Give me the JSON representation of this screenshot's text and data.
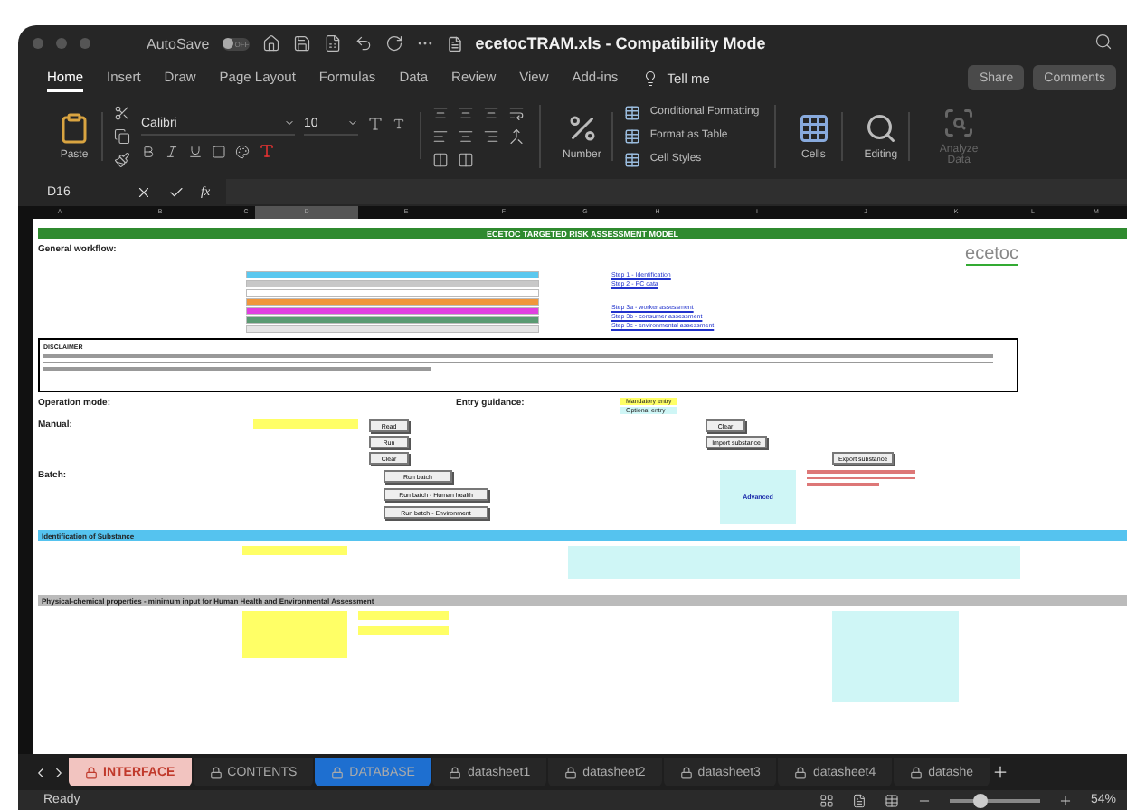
{
  "window": {
    "title": "ecetocTRAM.xls  -  Compatibility Mode",
    "autosave": "AutoSave",
    "autosave_state": "OFF",
    "autosave_on": false
  },
  "ribbon_tabs": [
    {
      "label": "Home",
      "selected": true
    },
    {
      "label": "Insert",
      "selected": false
    },
    {
      "label": "Draw",
      "selected": false
    },
    {
      "label": "Page Layout",
      "selected": false
    },
    {
      "label": "Formulas",
      "selected": false
    },
    {
      "label": "Data",
      "selected": false
    },
    {
      "label": "Review",
      "selected": false
    },
    {
      "label": "View",
      "selected": false
    },
    {
      "label": "Add-ins",
      "selected": false
    }
  ],
  "tell_me": "Tell me",
  "share": "Share",
  "comments": "Comments",
  "ribbon": {
    "paste": "Paste",
    "font": "Calibri",
    "size": "10",
    "number": "Number",
    "styles": [
      "Conditional Formatting",
      "Format as Table",
      "Cell Styles"
    ],
    "cells": "Cells",
    "editing": "Editing",
    "analyze": {
      "label": "Analyze Data",
      "disabled": true
    }
  },
  "formula_bar": {
    "cell": "D16",
    "fx": "fx"
  },
  "columns": [
    {
      "label": "A",
      "selected": false
    },
    {
      "label": "B",
      "selected": false
    },
    {
      "label": "C",
      "selected": false
    },
    {
      "label": "D",
      "selected": true
    },
    {
      "label": "E",
      "selected": false
    },
    {
      "label": "F",
      "selected": false
    },
    {
      "label": "G",
      "selected": false
    },
    {
      "label": "H",
      "selected": false
    },
    {
      "label": "I",
      "selected": false
    },
    {
      "label": "J",
      "selected": false
    },
    {
      "label": "K",
      "selected": false
    },
    {
      "label": "L",
      "selected": false
    },
    {
      "label": "M",
      "selected": false
    }
  ],
  "sheet": {
    "title": "ECETOC TARGETED RISK ASSESSMENT MODEL",
    "logo": "ecetoc",
    "workflow_heading": "General workflow:",
    "steps": [
      {
        "color": "#5bc8ef"
      },
      {
        "color": "#c8c8c8"
      },
      {
        "color": "#ffffff"
      },
      {
        "color": "#f0963c"
      },
      {
        "color": "#e040e0"
      },
      {
        "color": "#5a9a72"
      },
      {
        "color": "#e4e4e4"
      }
    ],
    "links": [
      "Step 1 - Identification",
      "Step 2 - PC data",
      "Step 3a - worker assessment",
      "Step 3b - consumer assessment",
      "Step 3c - environmental assessment"
    ],
    "disclaimer": "DISCLAIMER",
    "operation_mode": "Operation mode:",
    "entry_guidance": "Entry guidance:",
    "legend": [
      {
        "label": "Mandatory entry",
        "color": "#ffff66"
      },
      {
        "label": "Optional entry",
        "color": "#cff6f6"
      }
    ],
    "manual": {
      "heading": "Manual:",
      "buttons": [
        "Read",
        "Run",
        "Clear"
      ],
      "side_buttons": [
        "Clear",
        "Import substance",
        "Export substance"
      ]
    },
    "batch": {
      "heading": "Batch:",
      "buttons": [
        "Run batch",
        "Run batch - Human health",
        "Run batch - Environment"
      ],
      "advanced": "Advanced"
    },
    "identification": "Identification of Substance",
    "physchem": "Physical-chemical properties - minimum input for Human Health and Environmental Assessment"
  },
  "sheet_tabs": [
    {
      "label": "INTERFACE",
      "color": "#f2c4c0",
      "selected": true
    },
    {
      "label": "CONTENTS",
      "color": "#262626",
      "selected": false
    },
    {
      "label": "DATABASE",
      "color": "#1e6fd0",
      "selected": false
    },
    {
      "label": "datasheet1",
      "color": "#262626",
      "selected": false
    },
    {
      "label": "datasheet2",
      "color": "#262626",
      "selected": false
    },
    {
      "label": "datasheet3",
      "color": "#262626",
      "selected": false
    },
    {
      "label": "datasheet4",
      "color": "#262626",
      "selected": false
    },
    {
      "label": "datashe",
      "color": "#262626",
      "selected": false
    }
  ],
  "status_bar": {
    "status": "Ready",
    "zoom": "54%",
    "level": 0.35
  }
}
